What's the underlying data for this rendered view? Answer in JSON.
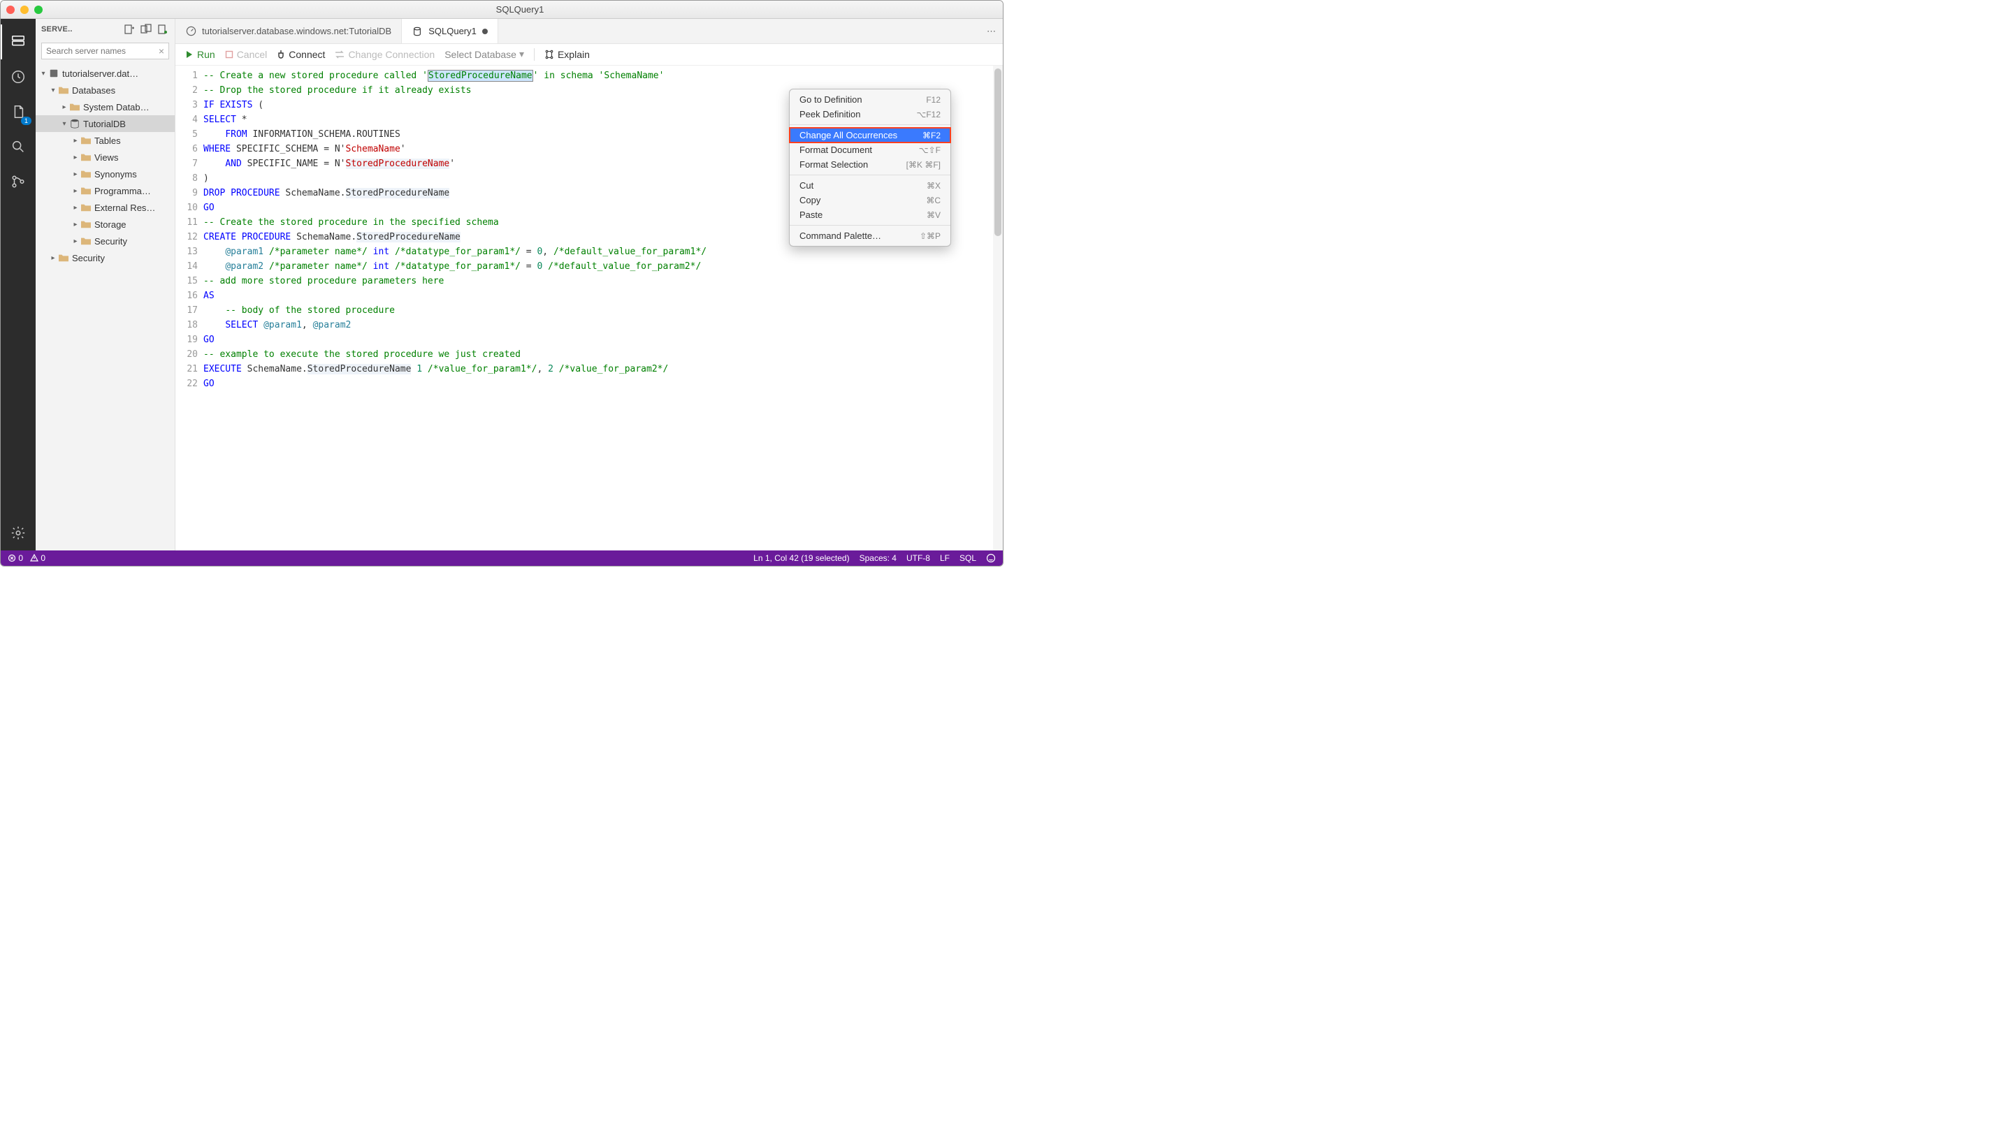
{
  "window": {
    "title": "SQLQuery1"
  },
  "activityBar": {
    "icons": [
      "files",
      "recent",
      "new-file-badge",
      "search",
      "branch"
    ],
    "badge": "1",
    "bottom": [
      "settings"
    ]
  },
  "sidebar": {
    "title": "SERVE..",
    "searchPlaceholder": "Search server names",
    "tree": {
      "server": "tutorialserver.dat…",
      "databasesLabel": "Databases",
      "systemDb": "System Datab…",
      "tutorialDb": "TutorialDB",
      "children": [
        "Tables",
        "Views",
        "Synonyms",
        "Programma…",
        "External Res…",
        "Storage",
        "Security"
      ],
      "security": "Security"
    }
  },
  "tabs": {
    "tab1": "tutorialserver.database.windows.net:TutorialDB",
    "tab2": "SQLQuery1"
  },
  "toolbar": {
    "run": "Run",
    "cancel": "Cancel",
    "connect": "Connect",
    "changeConn": "Change Connection",
    "selectDb": "Select Database",
    "explain": "Explain"
  },
  "contextMenu": {
    "items": [
      {
        "label": "Go to Definition",
        "shortcut": "F12"
      },
      {
        "label": "Peek Definition",
        "shortcut": "⌥F12"
      }
    ],
    "highlighted": {
      "label": "Change All Occurrences",
      "shortcut": "⌘F2"
    },
    "items2": [
      {
        "label": "Format Document",
        "shortcut": "⌥⇧F"
      },
      {
        "label": "Format Selection",
        "shortcut": "[⌘K ⌘F]"
      }
    ],
    "items3": [
      {
        "label": "Cut",
        "shortcut": "⌘X"
      },
      {
        "label": "Copy",
        "shortcut": "⌘C"
      },
      {
        "label": "Paste",
        "shortcut": "⌘V"
      }
    ],
    "items4": [
      {
        "label": "Command Palette…",
        "shortcut": "⇧⌘P"
      }
    ]
  },
  "code": {
    "lines": [
      "-- Create a new stored procedure called 'StoredProcedureName' in schema 'SchemaName'",
      "-- Drop the stored procedure if it already exists",
      "IF EXISTS (",
      "SELECT *",
      "    FROM INFORMATION_SCHEMA.ROUTINES",
      "WHERE SPECIFIC_SCHEMA = N'SchemaName'",
      "    AND SPECIFIC_NAME = N'StoredProcedureName'",
      ")",
      "DROP PROCEDURE SchemaName.StoredProcedureName",
      "GO",
      "-- Create the stored procedure in the specified schema",
      "CREATE PROCEDURE SchemaName.StoredProcedureName",
      "    @param1 /*parameter name*/ int /*datatype_for_param1*/ = 0, /*default_value_for_param1*/",
      "    @param2 /*parameter name*/ int /*datatype_for_param1*/ = 0 /*default_value_for_param2*/",
      "-- add more stored procedure parameters here",
      "AS",
      "    -- body of the stored procedure",
      "    SELECT @param1, @param2",
      "GO",
      "-- example to execute the stored procedure we just created",
      "EXECUTE SchemaName.StoredProcedureName 1 /*value_for_param1*/, 2 /*value_for_param2*/",
      "GO"
    ]
  },
  "statusbar": {
    "errors": "0",
    "warnings": "0",
    "cursor": "Ln 1, Col 42 (19 selected)",
    "spaces": "Spaces: 4",
    "encoding": "UTF-8",
    "eol": "LF",
    "lang": "SQL"
  }
}
